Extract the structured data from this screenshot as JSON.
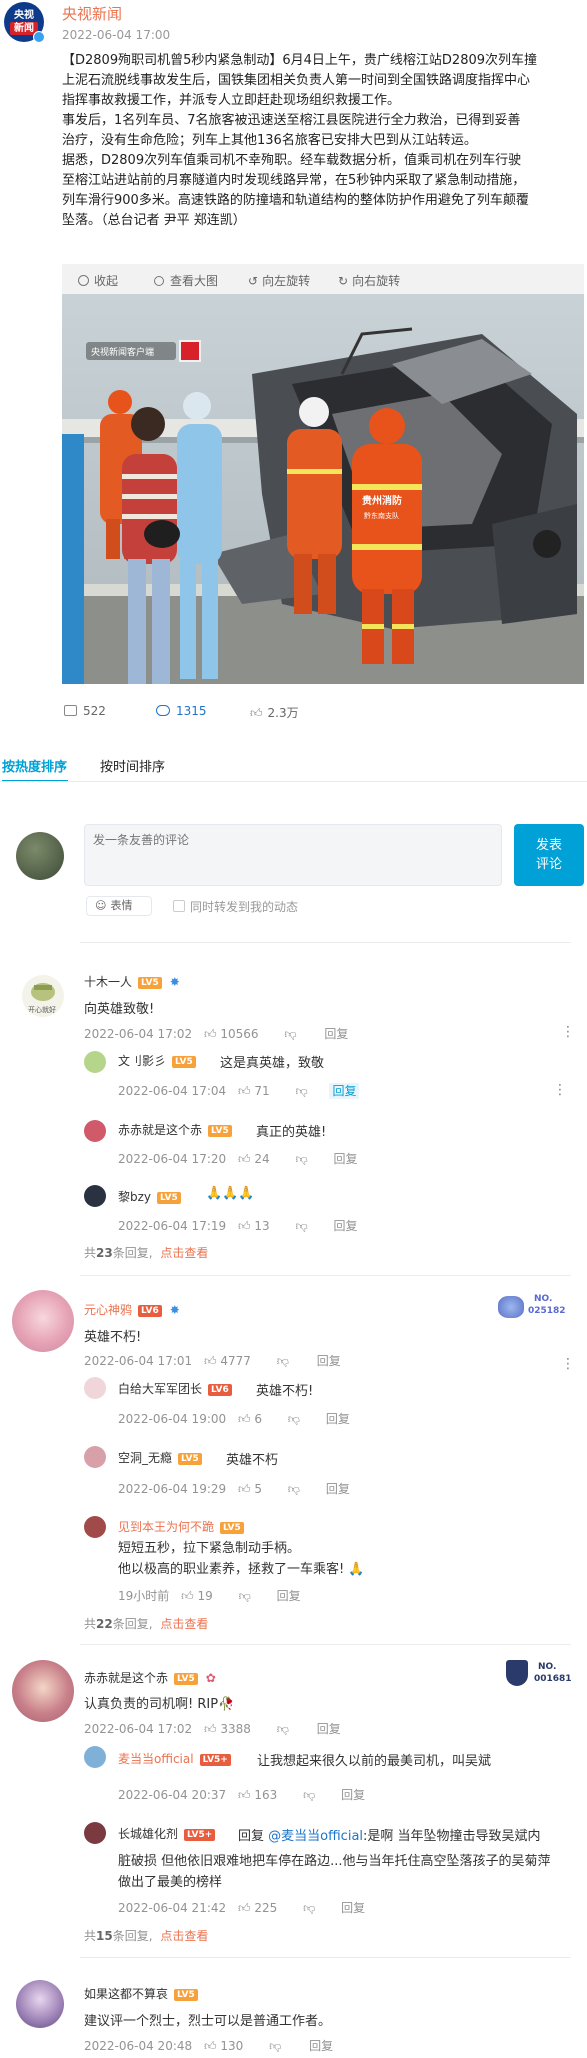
{
  "post": {
    "author": "央视新闻",
    "time": "2022-06-04 17:00",
    "avatar_text_1": "央视",
    "avatar_text_2": "新闻",
    "content_lines": [
      "【D2809殉职司机曾5秒内紧急制动】6月4日上午，贵广线榕江站D2809次列车撞",
      "上泥石流脱线事故发生后，国铁集团相关负责人第一时间到全国铁路调度指挥中心",
      "指挥事故救援工作，并派专人立即赶赴现场组织救援工作。",
      "事发后，1名列车员、7名旅客被迅速送至榕江县医院进行全力救治，已得到妥善",
      "治疗，没有生命危险；列车上其他136名旅客已安排大巴到从江站转运。",
      "据悉，D2809次列车值乘司机不幸殉职。经车载数据分析，值乘司机在列车行驶",
      "至榕江站进站前的月寨隧道内时发现线路异常，在5秒钟内采取了紧急制动措施，",
      "列车滑行900多米。高速铁路的防撞墙和轨道结构的整体防护作用避免了列车颠覆",
      "坠落。（总台记者 尹平 郑连凯）"
    ],
    "image_toolbar": [
      "收起",
      "查看大图",
      "向左旋转",
      "向右旋转"
    ],
    "image_watermark": "央视新闻客户端",
    "image_vest_text": "贵州消防",
    "image_vest_sub": "黔东南支队",
    "stats": {
      "repost": "522",
      "comments": "1315",
      "likes": "2.3万"
    }
  },
  "tabs": [
    "按热度排序",
    "按时间排序"
  ],
  "composer": {
    "placeholder": "发一条友善的评论",
    "submit": "发表评论",
    "emoji": "表情",
    "repost_label": "同时转发到我的动态"
  },
  "comments": [
    {
      "name": "十木一人",
      "level": "LV5",
      "text": "向英雄致敬!",
      "time": "2022-06-04 17:02",
      "likes": "10566",
      "reply_label": "回复",
      "replies": [
        {
          "name": "文刂影彡",
          "level": "LV5",
          "text": "这是真英雄，致敬",
          "time": "2022-06-04 17:04",
          "likes": "71",
          "reply_label": "回复"
        },
        {
          "name": "赤赤就是这个赤",
          "level": "LV5",
          "text": "真正的英雄!",
          "time": "2022-06-04 17:20",
          "likes": "24",
          "reply_label": "回复"
        },
        {
          "name": "黎bzy",
          "level": "LV5",
          "text": "🙏🙏🙏",
          "time": "2022-06-04 17:19",
          "likes": "13",
          "reply_label": "回复"
        }
      ],
      "reply_total_prefix": "共",
      "reply_total": "23",
      "reply_total_suffix": "条回复,",
      "view_more": "点击查看"
    },
    {
      "name": "元心神鸦",
      "level": "LV6",
      "badge_no": "NO.",
      "badge_num": "025182",
      "text": "英雄不朽!",
      "time": "2022-06-04 17:01",
      "likes": "4777",
      "reply_label": "回复",
      "replies": [
        {
          "name": "白给大军军团长",
          "level": "LV6",
          "text": "英雄不朽!",
          "time": "2022-06-04 19:00",
          "likes": "6",
          "reply_label": "回复"
        },
        {
          "name": "空洞_无瘾",
          "level": "LV5",
          "text": "英雄不朽",
          "time": "2022-06-04 19:29",
          "likes": "5",
          "reply_label": "回复"
        },
        {
          "name": "见到本王为何不跪",
          "level": "LV5",
          "text": "短短五秒，拉下紧急制动手柄。",
          "text2": "他以极高的职业素养，拯救了一车乘客! 🙏",
          "time": "19小时前",
          "likes": "19",
          "reply_label": "回复"
        }
      ],
      "reply_total_prefix": "共",
      "reply_total": "22",
      "reply_total_suffix": "条回复,",
      "view_more": "点击查看"
    },
    {
      "name": "赤赤就是这个赤",
      "level": "LV5",
      "badge_no": "NO.",
      "badge_num": "001681",
      "text": "认真负责的司机啊! RIP🥀",
      "time": "2022-06-04 17:02",
      "likes": "3388",
      "reply_label": "回复",
      "replies": [
        {
          "name": "麦当当official",
          "level": "LV5+",
          "text": "让我想起来很久以前的最美司机，叫吴斌",
          "time": "2022-06-04 20:37",
          "likes": "163",
          "reply_label": "回复"
        },
        {
          "name": "长城雄化剂",
          "level": "LV5+",
          "reply_prefix": "回复",
          "mention": "@麦当当official",
          "text": ":是啊 当年坠物撞击导致吴斌内",
          "text2": "脏破损 但他依旧艰难地把车停在路边...他与当年托住高空坠落孩子的吴菊萍",
          "text3": "做出了最美的榜样",
          "time": "2022-06-04 21:42",
          "likes": "225",
          "reply_label": "回复"
        }
      ],
      "reply_total_prefix": "共",
      "reply_total": "15",
      "reply_total_suffix": "条回复,",
      "view_more": "点击查看"
    },
    {
      "name": "如果这都不算哀",
      "level": "LV5",
      "text": "建议评一个烈士，烈士可以是普通工作者。",
      "time": "2022-06-04 20:48",
      "likes": "130",
      "reply_label": "回复"
    }
  ],
  "colors": {
    "accent": "#00a1d6",
    "orange": "#eb7350",
    "blue_link": "#1d74c9"
  }
}
